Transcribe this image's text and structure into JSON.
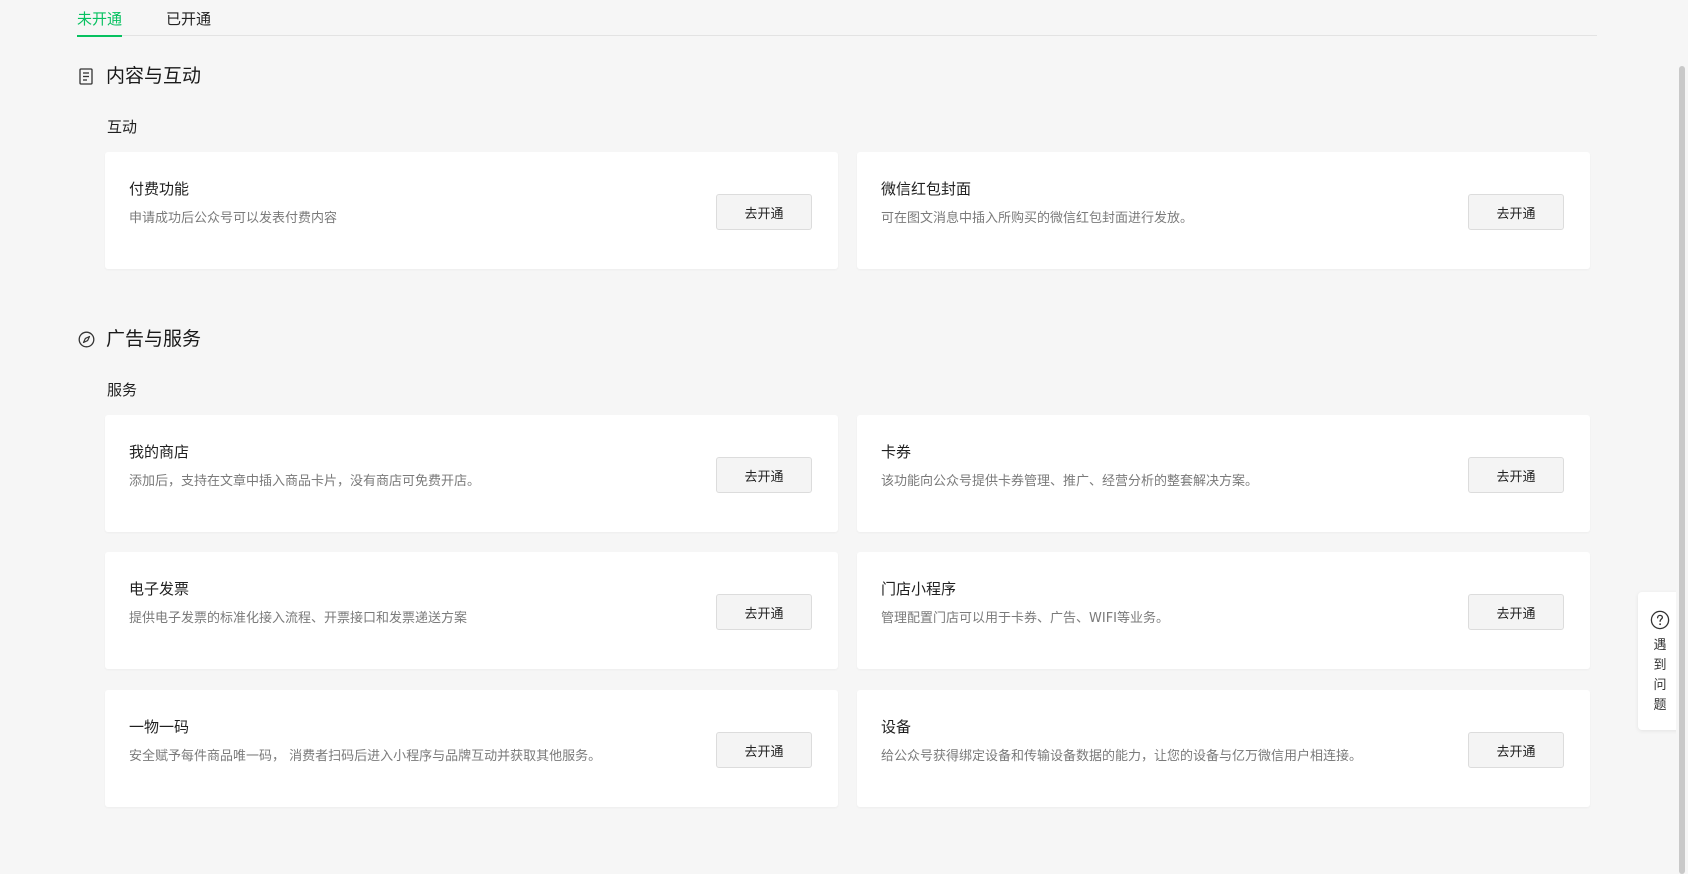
{
  "tabs": [
    {
      "label": "未开通",
      "active": true
    },
    {
      "label": "已开通",
      "active": false
    }
  ],
  "sections": [
    {
      "icon": "document-icon",
      "title": "内容与互动",
      "subtitle": "互动"
    },
    {
      "icon": "compass-icon",
      "title": "广告与服务",
      "subtitle": "服务"
    }
  ],
  "cards": [
    {
      "title": "付费功能",
      "desc": "申请成功后公众号可以发表付费内容",
      "button": "去开通"
    },
    {
      "title": "微信红包封面",
      "desc": "可在图文消息中插入所购买的微信红包封面进行发放。",
      "button": "去开通"
    },
    {
      "title": "我的商店",
      "desc": "添加后，支持在文章中插入商品卡片，没有商店可免费开店。",
      "button": "去开通"
    },
    {
      "title": "卡券",
      "desc": "该功能向公众号提供卡券管理、推广、经营分析的整套解决方案。",
      "button": "去开通"
    },
    {
      "title": "电子发票",
      "desc": "提供电子发票的标准化接入流程、开票接口和发票递送方案",
      "button": "去开通"
    },
    {
      "title": "门店小程序",
      "desc": "管理配置门店可以用于卡券、广告、WIFI等业务。",
      "button": "去开通"
    },
    {
      "title": "一物一码",
      "desc": "安全赋予每件商品唯一码， 消费者扫码后进入小程序与品牌互动并获取其他服务。",
      "button": "去开通"
    },
    {
      "title": "设备",
      "desc": "给公众号获得绑定设备和传输设备数据的能力，让您的设备与亿万微信用户相连接。",
      "button": "去开通"
    }
  ],
  "help": {
    "label": "遇到问题",
    "icon": "question-circle-icon"
  },
  "colors": {
    "accent": "#07c160",
    "background": "#f6f6f6",
    "card": "#ffffff"
  }
}
